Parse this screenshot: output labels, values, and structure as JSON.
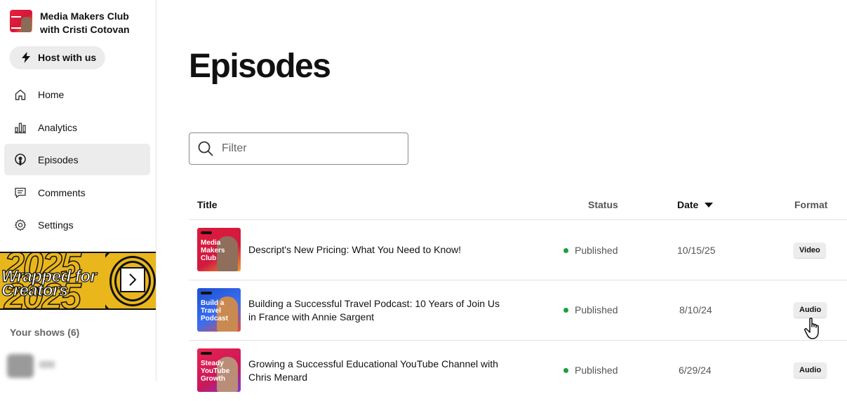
{
  "show": {
    "title": "Media Makers Club with Cristi Cotovan"
  },
  "sidebar": {
    "host_button": "Host with us",
    "items": [
      {
        "label": "Home",
        "icon": "home-icon"
      },
      {
        "label": "Analytics",
        "icon": "bar-chart-icon"
      },
      {
        "label": "Episodes",
        "icon": "podcast-icon",
        "active": true
      },
      {
        "label": "Comments",
        "icon": "comment-icon"
      },
      {
        "label": "Settings",
        "icon": "gear-icon"
      }
    ],
    "banner": {
      "year": "2025",
      "text": "Wrapped for Creators"
    },
    "your_shows": "Your shows (6)"
  },
  "main": {
    "title": "Episodes",
    "filter_placeholder": "Filter",
    "columns": {
      "title": "Title",
      "status": "Status",
      "date": "Date",
      "format": "Format"
    },
    "episodes": [
      {
        "title": "Descript's New Pricing: What You Need to Know!",
        "status": "Published",
        "date": "10/15/25",
        "format": "Video",
        "thumb_label": "Media Makers Club"
      },
      {
        "title": "Building a Successful Travel Podcast: 10 Years of Join Us in France with Annie Sargent",
        "status": "Published",
        "date": "8/10/24",
        "format": "Audio",
        "thumb_label": "Build a Travel Podcast"
      },
      {
        "title": "Growing a Successful Educational YouTube Channel with Chris Menard",
        "status": "Published",
        "date": "6/29/24",
        "format": "Audio",
        "thumb_label": "Steady YouTube Growth"
      }
    ]
  },
  "colors": {
    "accent_gray": "#ececec",
    "status_green": "#1f9d3c",
    "banner_yellow": "#e9b61c"
  }
}
